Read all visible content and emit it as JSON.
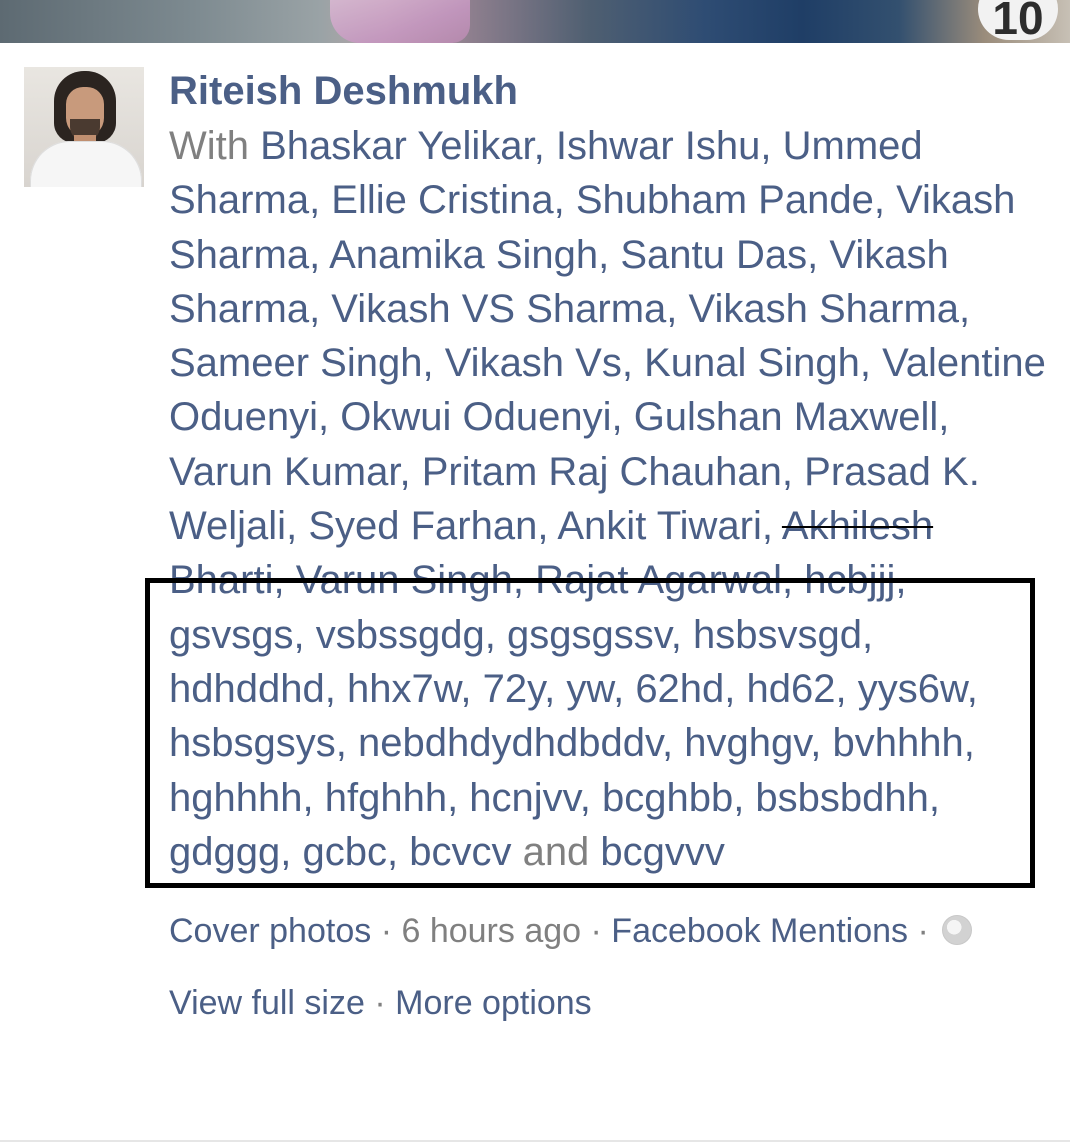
{
  "cover": {
    "badge_text": "10"
  },
  "post": {
    "author": "Riteish Deshmukh",
    "with_label": "With",
    "tagged_before_strike": [
      "Bhaskar Yelikar",
      "Ishwar Ishu",
      "Ummed Sharma",
      "Ellie Cristina",
      "Shubham Pande",
      "Vikash Sharma",
      "Anamika Singh",
      "Santu Das",
      "Vikash Sharma",
      "Vikash VS Sharma",
      "Vikash Sharma",
      "Sameer Singh",
      "Vikash Vs",
      "Kunal Singh",
      "Valentine Oduenyi",
      "Okwui Oduenyi",
      "Gulshan Maxwell",
      "Varun Kumar",
      "Pritam Raj Chauhan",
      "Prasad K. Weljali",
      "Syed Farhan",
      "Ankit Tiwari"
    ],
    "tagged_struck": [
      "Akhilesh Bharti",
      "Varun Singh",
      "Rajat Agarwal"
    ],
    "tagged_boxed": [
      "hcbjjj",
      "gsvsgs",
      "vsbssgdg",
      "gsgsgssv",
      "hsbsvsgd",
      "hdhddhd",
      "hhx7w",
      "72y",
      "yw",
      "62hd",
      "hd62",
      "yys6w",
      "hsbsgsys",
      "nebdhdydhdbddv",
      "hvghgv",
      "bvhhhh",
      "hghhhh",
      "hfghhh",
      "hcnjvv",
      "bcghbb",
      "bsbsbdhh",
      "gdggg",
      "gcbc",
      "bcvcv"
    ],
    "and_label": "and",
    "last_tag": "bcgvvv",
    "meta": {
      "album": "Cover photos",
      "separator": "·",
      "time": "6 hours ago",
      "source": "Facebook Mentions",
      "privacy_icon": "globe-icon"
    },
    "actions": {
      "view_full_size": "View full size",
      "more_options": "More options"
    }
  },
  "colors": {
    "link": "#4b5f86",
    "muted": "#808080",
    "highlight_border": "#000000"
  }
}
